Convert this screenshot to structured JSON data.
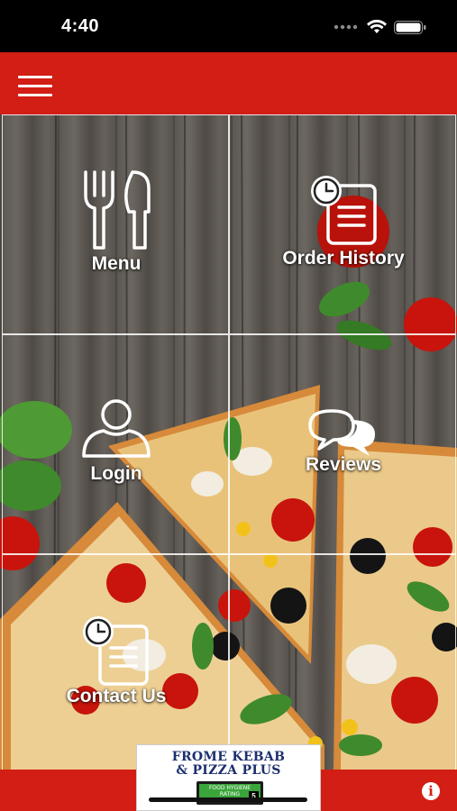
{
  "status_bar": {
    "time": "4:40",
    "icons": [
      "signal-dots-icon",
      "wifi-icon",
      "battery-icon"
    ]
  },
  "header": {
    "menu_icon": "hamburger-menu-icon",
    "background_color": "#d21e14"
  },
  "tiles": [
    {
      "label": "Menu",
      "icon": "fork-knife-icon"
    },
    {
      "label": "Order History",
      "icon": "clock-document-icon"
    },
    {
      "label": "Login",
      "icon": "user-icon"
    },
    {
      "label": "Reviews",
      "icon": "chat-bubbles-icon"
    },
    {
      "label": "Contact Us",
      "icon": "clock-document-icon"
    }
  ],
  "footer": {
    "logo_line1": "FROME KEBAB",
    "logo_line2": "& PIZZA PLUS",
    "rating_title": "FOOD HYGIENE RATING",
    "rating_score": "5",
    "info_icon": "info-icon",
    "info_glyph": "i"
  },
  "colors": {
    "brand_red": "#d21e14",
    "tile_border": "#ffffff"
  }
}
